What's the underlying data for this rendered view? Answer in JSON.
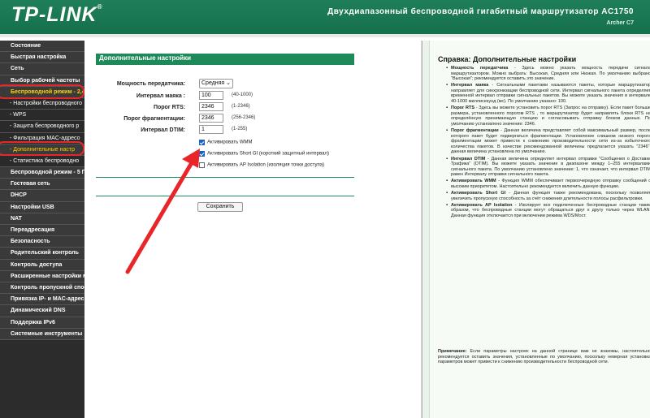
{
  "header": {
    "logo": "TP-LINK",
    "model_title": "Двухдиапазонный беспроводной гигабитный маршрутизатор AC1750",
    "model_sub": "Archer C7"
  },
  "sidebar": {
    "items": [
      {
        "label": "Состояние",
        "sub": false,
        "active": false
      },
      {
        "label": "Быстрая настройка",
        "sub": false,
        "active": false
      },
      {
        "label": "Сеть",
        "sub": false,
        "active": false
      },
      {
        "label": "Выбор рабочей частоты",
        "sub": false,
        "active": false
      },
      {
        "label": "Беспроводной режим - 2,4",
        "sub": false,
        "active": true
      },
      {
        "label": "- Настройки беспроводного",
        "sub": true,
        "active": false
      },
      {
        "label": "- WPS",
        "sub": true,
        "active": false
      },
      {
        "label": "- Защита беспроводного р",
        "sub": true,
        "active": false
      },
      {
        "label": "- Фильтрация MAC-адресо",
        "sub": true,
        "active": false
      },
      {
        "label": "- Дополнительные настр",
        "sub": true,
        "active": true
      },
      {
        "label": "- Статистика беспроводно",
        "sub": true,
        "active": false
      },
      {
        "label": "Беспроводной режим - 5 Г",
        "sub": false,
        "active": false
      },
      {
        "label": "Гостевая сеть",
        "sub": false,
        "active": false
      },
      {
        "label": "DHCP",
        "sub": false,
        "active": false
      },
      {
        "label": "Настройки USB",
        "sub": false,
        "active": false
      },
      {
        "label": "NAT",
        "sub": false,
        "active": false
      },
      {
        "label": "Переадресация",
        "sub": false,
        "active": false
      },
      {
        "label": "Безопасность",
        "sub": false,
        "active": false
      },
      {
        "label": "Родительский контроль",
        "sub": false,
        "active": false
      },
      {
        "label": "Контроль доступа",
        "sub": false,
        "active": false
      },
      {
        "label": "Расширенные настройки м",
        "sub": false,
        "active": false
      },
      {
        "label": "Контроль пропускной спос",
        "sub": false,
        "active": false
      },
      {
        "label": "Привязка IP- и MAC-адрес",
        "sub": false,
        "active": false
      },
      {
        "label": "Динамический DNS",
        "sub": false,
        "active": false
      },
      {
        "label": "Поддержка IPv6",
        "sub": false,
        "active": false
      },
      {
        "label": "Системные инструменты",
        "sub": false,
        "active": false
      }
    ]
  },
  "main": {
    "section_title": "Дополнительные настройки",
    "tx_power": {
      "label": "Мощность передатчика:",
      "value": "Средняя"
    },
    "beacon": {
      "label": "Интервал маяка :",
      "value": "100",
      "hint": "(40-1000)"
    },
    "rts": {
      "label": "Порог RTS:",
      "value": "2346",
      "hint": "(1-2346)"
    },
    "frag": {
      "label": "Порог фрагментации:",
      "value": "2346",
      "hint": "(256-2346)"
    },
    "dtim": {
      "label": "Интервал DTIM:",
      "value": "1",
      "hint": "(1-255)"
    },
    "wmm": {
      "label": "Активировать WMM",
      "checked": true
    },
    "short_gi": {
      "label": "Активировать Short GI (короткий защитный интервал)",
      "checked": true
    },
    "ap_isolation": {
      "label": "Активировать AP Isolation (изоляция точки доступа)",
      "checked": false
    },
    "save_label": "Сохранить"
  },
  "help": {
    "title": "Справка: Дополнительные настройки",
    "items": [
      {
        "term": "Мощность передатчика",
        "text": " - Здесь можно указать мощность передачи сигнала маршрутизатором. Можно выбрать: Высокая, Средняя или Низкая. По умолчанию выбрано \"Высокая\"; рекомендуется оставить это значение."
      },
      {
        "term": "Интервал маяка",
        "text": " - Сигнальными пакетами называются пакеты, которые маршрутизатор направляет для синхронизации беспроводной сети. Интервал сигнального пакета определяет временной интервал отправки сигнальных пакетов. Вы можете указать значения в интервале 40-1000 миллисекунд (мс). По умолчанию указано: 100."
      },
      {
        "term": "Порог RTS",
        "text": " - Здесь вы можете установить порог RTS (Запрос на отправку). Если пакет больше размера, установленного порогом RTS , то маршрутизатор будет направлять блоки RTS на определённую принимающую станцию и согласовывать отправку блоков данных. По умолчанию установлено значение: 2346."
      },
      {
        "term": "Порог фрагментации",
        "text": " - Данная величина представляет собой максимальный размер, после которого пакет будет подвергаться фрагментации. Установление слишком низкого порога фрагментации может привести к снижению производительности сети из-за избыточного количества пакетов. В качестве рекомендованной величины предлагается указать \"2346\"; данная величина установлена по умолчанию."
      },
      {
        "term": "Интервал DTIM",
        "text": " - Данная величина определяет интервал отправки \"Сообщения о Доставке Трафика\" (DTIM). Вы можете указать значение в диапазоне между 1–255 интервалами сигнального пакета. По умолчанию установлено значение: 1, что означает, что интервал DTIM равен Интервалу отправки сигнального пакета."
      },
      {
        "term": "Активировать WMM",
        "text": " - Функция WMM обеспечивает первоочередную отправку сообщений с высоким приоритетом. Настоятельно рекомендуется включить данную функцию."
      },
      {
        "term": "Активировать Short GI",
        "text": " - Данная функция также рекомендована, поскольку позволяет увеличить пропускную способность за счёт снижения длительности полосы расфильтровки."
      },
      {
        "term": "Активировать AP Isolation",
        "text": " - Изолирует все подключенные беспроводные станции таким образом, что беспроводные станции могут обращаться друг к другу только через WLAN. Данная функция отключается при включении режима WDS/Мост."
      }
    ],
    "note_term": "Примечание:",
    "note_text": " Если параметры настроек на данной странице вам не знакомы, настоятельно рекомендуется оставить значения, установленные по умолчанию, поскольку неверная установка параметров может привести к снижению производительности беспроводной сети."
  },
  "colors": {
    "header_green": "#1f7f5a",
    "sidebar_bg": "#2c2c2c",
    "active_text": "#ffd000",
    "annotation_red": "#e8262a",
    "help_bg": "#f6fbf6"
  }
}
